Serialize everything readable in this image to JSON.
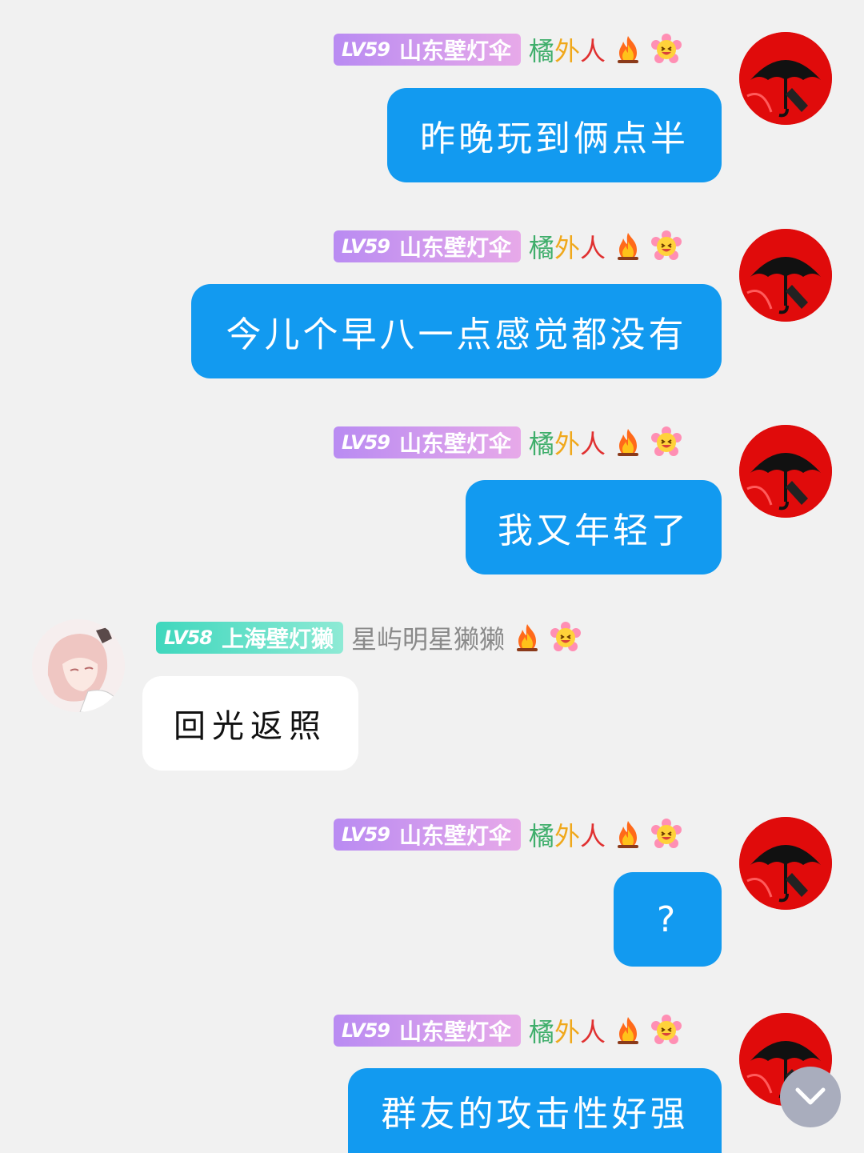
{
  "colors": {
    "background": "#f1f1f1",
    "bubble_blue": "#129af0",
    "bubble_white": "#ffffff",
    "badge_purple": "#b98bf2",
    "badge_teal": "#3fd7bd",
    "avatar_red": "#e00b0b"
  },
  "sender_a": {
    "level": "LV59",
    "title": "山东壁灯伞",
    "nick_parts": [
      "橘",
      "外",
      "人"
    ],
    "icons": [
      "fire-icon",
      "smile-flower-icon"
    ]
  },
  "sender_b": {
    "level": "LV58",
    "title": "上海壁灯獭",
    "nick": "星屿明星獭獭",
    "icons": [
      "fire-icon",
      "smile-flower-icon"
    ]
  },
  "messages": [
    {
      "text": "昨晚玩到俩点半"
    },
    {
      "text": "今儿个早八一点感觉都没有"
    },
    {
      "text": "我又年轻了"
    },
    {
      "text": "回光返照"
    },
    {
      "text": "?"
    },
    {
      "text": "群友的攻击性好强"
    }
  ],
  "scroll_button": {
    "icon": "chevron-down-icon"
  }
}
